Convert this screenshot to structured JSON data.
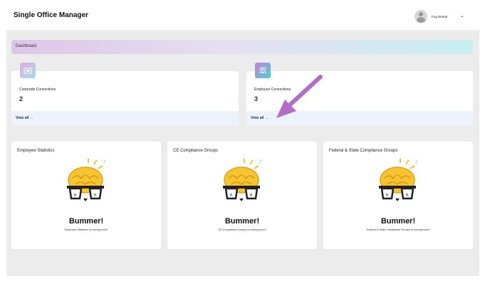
{
  "app": {
    "title": "Single Office Manager"
  },
  "user": {
    "name": "Fog Dental"
  },
  "breadcrumb": {
    "label": "Dashboard"
  },
  "connections": [
    {
      "label": "Corporate Connections",
      "value": "2",
      "link": "View all →"
    },
    {
      "label": "Employee Connections",
      "value": "3",
      "link": "View all →"
    }
  ],
  "stats": [
    {
      "title": "Employee Statistics",
      "heading": "Bummer!",
      "message": "Employee Statistics is coming soon!"
    },
    {
      "title": "CE Compliance Groups",
      "heading": "Bummer!",
      "message": "CE Compliance Groups is coming soon!"
    },
    {
      "title": "Federal & State Compliance Groups",
      "heading": "Bummer!",
      "message": "Federal & State Compliance Groups is coming soon!"
    }
  ],
  "colors": {
    "accent": "#1e2a6e",
    "arrow": "#b36cc9",
    "brain": "#f6c431"
  },
  "icons": {
    "connection": "building-icon",
    "employee": "people-icon",
    "dropdown": "chevron-down-icon",
    "annotation": "arrow-annotation"
  }
}
